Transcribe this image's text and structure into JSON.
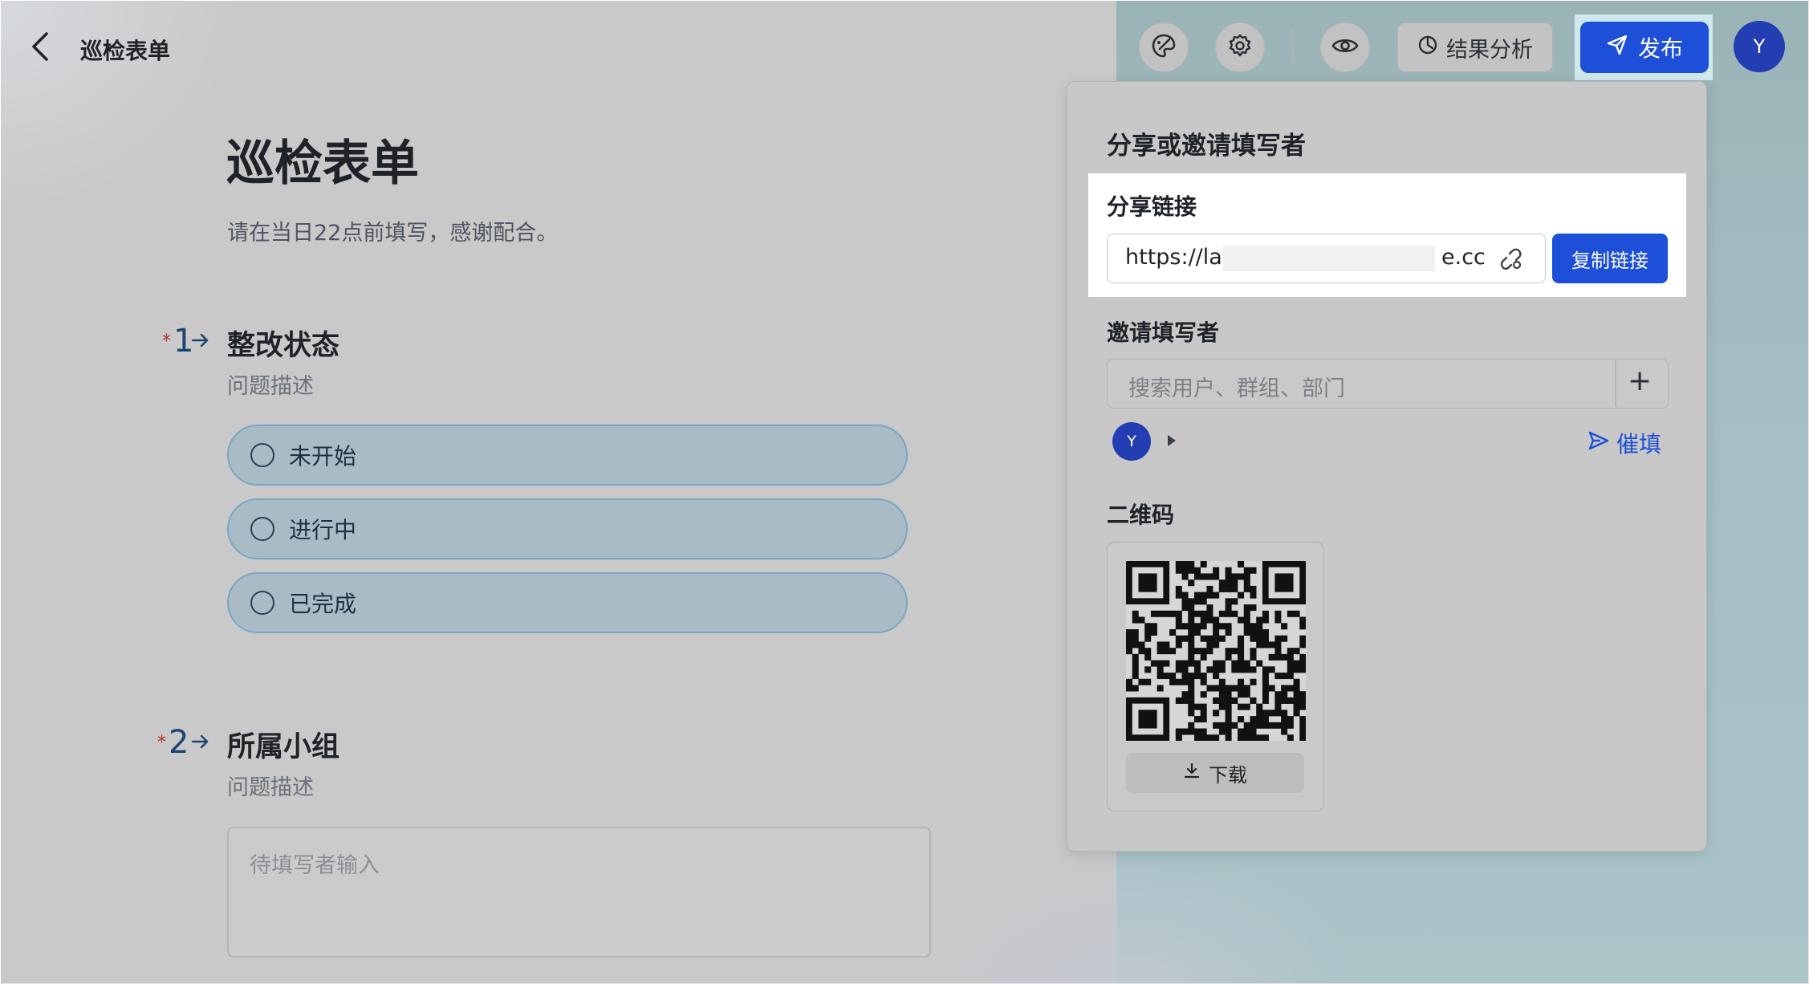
{
  "header": {
    "app_title": "巡检表单",
    "analysis_label": "结果分析",
    "publish_label": "发布",
    "avatar_initial": "Y"
  },
  "form": {
    "title": "巡检表单",
    "description": "请在当日22点前填写，感谢配合。",
    "questions": [
      {
        "star": "*",
        "number": "1",
        "title": "整改状态",
        "subtitle": "问题描述",
        "options": [
          "未开始",
          "进行中",
          "已完成"
        ]
      },
      {
        "star": "*",
        "number": "2",
        "title": "所属小组",
        "subtitle": "问题描述",
        "placeholder": "待填写者输入"
      }
    ]
  },
  "share_panel": {
    "title": "分享或邀请填写者",
    "share_link_label": "分享链接",
    "link_start": "https://lar",
    "link_end": "e.cc",
    "copy_label": "复制链接",
    "invite_label": "邀请填写者",
    "invite_placeholder": "搜索用户、群组、部门",
    "invite_add": "+",
    "invitee_initial": "Y",
    "remind_label": "催填",
    "qr_label": "二维码",
    "download_label": "下载"
  },
  "colors": {
    "accent": "#1d4fd8",
    "avatar": "#233db3",
    "required_star": "#c02c2c",
    "question_number": "#1e4471"
  }
}
